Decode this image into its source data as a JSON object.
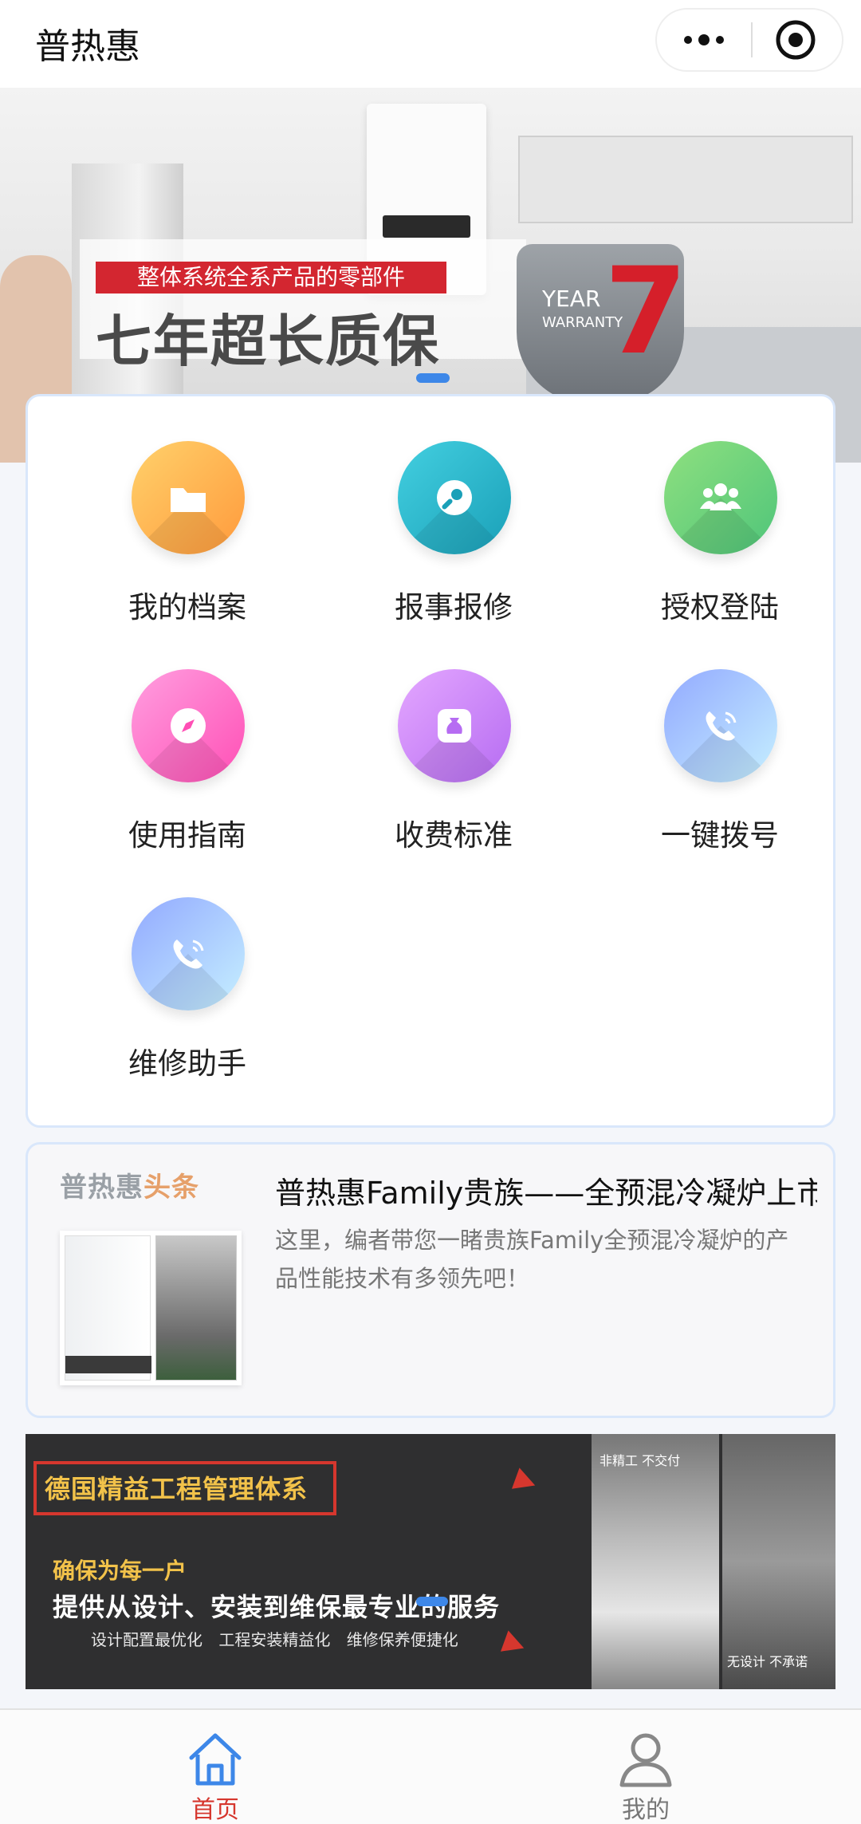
{
  "navbar": {
    "title": "普热惠"
  },
  "banner": {
    "red_label": "整体系统全系产品的零部件",
    "headline": "七年超长质保",
    "badge_year": "YEAR",
    "badge_warranty": "WARRANTY",
    "badge_number": "7"
  },
  "grid": {
    "items": [
      {
        "label": "我的档案",
        "icon": "folder-icon"
      },
      {
        "label": "报事报修",
        "icon": "wrench-icon"
      },
      {
        "label": "授权登陆",
        "icon": "users-icon"
      },
      {
        "label": "使用指南",
        "icon": "compass-icon"
      },
      {
        "label": "收费标准",
        "icon": "money-bag-icon"
      },
      {
        "label": "一键拨号",
        "icon": "phone-icon"
      },
      {
        "label": "维修助手",
        "icon": "phone-icon"
      }
    ]
  },
  "news": {
    "logo_main": "普热惠",
    "logo_accent": "头条",
    "title": "普热惠Family贵族——全预混冷凝炉上市",
    "description": "这里，编者带您一睹贵族Family全预混冷凝炉的产品性能技术有多领先吧！"
  },
  "promo": {
    "headline": "德国精益工程管理体系",
    "line2": "确保为每一户",
    "line3": "提供从设计、安装到维保最专业的服务",
    "line4": "设计配置最优化 工程安装精益化 维修保养便捷化",
    "photo_caption_1": "非精工 不交付",
    "photo_caption_2": "无设计 不承诺"
  },
  "tabbar": {
    "home_label": "首页",
    "me_label": "我的"
  },
  "colors": {
    "accent_red": "#d6372e",
    "accent_blue": "#3d87e8"
  }
}
